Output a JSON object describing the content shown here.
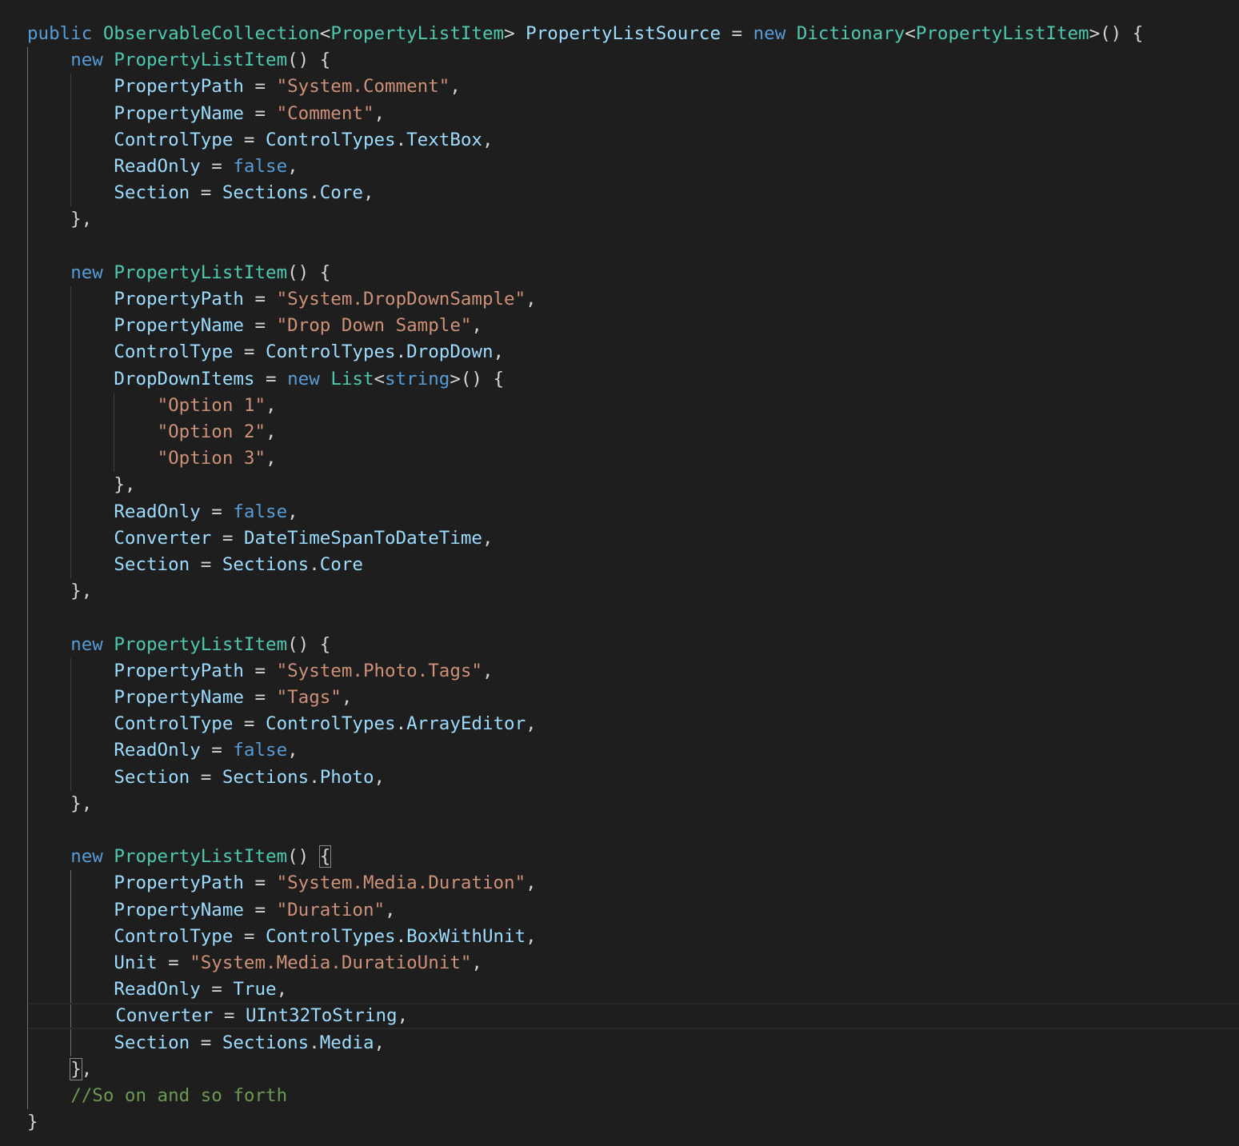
{
  "editor": {
    "language": "C#",
    "theme_colors": {
      "background": "#1e1e1e",
      "keyword": "#569cd6",
      "type": "#4ec9b0",
      "identifier": "#9cdcfe",
      "string": "#ce9178",
      "plain": "#d4d4d4",
      "comment": "#6a9955"
    },
    "lines": [
      [
        [
          "kw",
          "public"
        ],
        [
          "pl",
          " "
        ],
        [
          "ty",
          "ObservableCollection"
        ],
        [
          "pl",
          "<"
        ],
        [
          "ty",
          "PropertyListItem"
        ],
        [
          "pl",
          "> "
        ],
        [
          "id",
          "PropertyListSource"
        ],
        [
          "pl",
          " = "
        ],
        [
          "kw",
          "new"
        ],
        [
          "pl",
          " "
        ],
        [
          "ty",
          "Dictionary"
        ],
        [
          "pl",
          "<"
        ],
        [
          "ty",
          "PropertyListItem"
        ],
        [
          "pl",
          ">() {"
        ]
      ],
      [
        [
          "pl",
          "    "
        ],
        [
          "kw",
          "new"
        ],
        [
          "pl",
          " "
        ],
        [
          "ty",
          "PropertyListItem"
        ],
        [
          "pl",
          "() {"
        ]
      ],
      [
        [
          "pl",
          "        "
        ],
        [
          "id",
          "PropertyPath"
        ],
        [
          "pl",
          " = "
        ],
        [
          "str",
          "\"System.Comment\""
        ],
        [
          "pl",
          ","
        ]
      ],
      [
        [
          "pl",
          "        "
        ],
        [
          "id",
          "PropertyName"
        ],
        [
          "pl",
          " = "
        ],
        [
          "str",
          "\"Comment\""
        ],
        [
          "pl",
          ","
        ]
      ],
      [
        [
          "pl",
          "        "
        ],
        [
          "id",
          "ControlType"
        ],
        [
          "pl",
          " = "
        ],
        [
          "id",
          "ControlTypes"
        ],
        [
          "pl",
          "."
        ],
        [
          "id",
          "TextBox"
        ],
        [
          "pl",
          ","
        ]
      ],
      [
        [
          "pl",
          "        "
        ],
        [
          "id",
          "ReadOnly"
        ],
        [
          "pl",
          " = "
        ],
        [
          "kw",
          "false"
        ],
        [
          "pl",
          ","
        ]
      ],
      [
        [
          "pl",
          "        "
        ],
        [
          "id",
          "Section"
        ],
        [
          "pl",
          " = "
        ],
        [
          "id",
          "Sections"
        ],
        [
          "pl",
          "."
        ],
        [
          "id",
          "Core"
        ],
        [
          "pl",
          ","
        ]
      ],
      [
        [
          "pl",
          "    },"
        ]
      ],
      [],
      [
        [
          "pl",
          "    "
        ],
        [
          "kw",
          "new"
        ],
        [
          "pl",
          " "
        ],
        [
          "ty",
          "PropertyListItem"
        ],
        [
          "pl",
          "() {"
        ]
      ],
      [
        [
          "pl",
          "        "
        ],
        [
          "id",
          "PropertyPath"
        ],
        [
          "pl",
          " = "
        ],
        [
          "str",
          "\"System.DropDownSample\""
        ],
        [
          "pl",
          ","
        ]
      ],
      [
        [
          "pl",
          "        "
        ],
        [
          "id",
          "PropertyName"
        ],
        [
          "pl",
          " = "
        ],
        [
          "str",
          "\"Drop Down Sample\""
        ],
        [
          "pl",
          ","
        ]
      ],
      [
        [
          "pl",
          "        "
        ],
        [
          "id",
          "ControlType"
        ],
        [
          "pl",
          " = "
        ],
        [
          "id",
          "ControlTypes"
        ],
        [
          "pl",
          "."
        ],
        [
          "id",
          "DropDown"
        ],
        [
          "pl",
          ","
        ]
      ],
      [
        [
          "pl",
          "        "
        ],
        [
          "id",
          "DropDownItems"
        ],
        [
          "pl",
          " = "
        ],
        [
          "kw",
          "new"
        ],
        [
          "pl",
          " "
        ],
        [
          "ty",
          "List"
        ],
        [
          "pl",
          "<"
        ],
        [
          "kw",
          "string"
        ],
        [
          "pl",
          ">() {"
        ]
      ],
      [
        [
          "pl",
          "            "
        ],
        [
          "str",
          "\"Option 1\""
        ],
        [
          "pl",
          ","
        ]
      ],
      [
        [
          "pl",
          "            "
        ],
        [
          "str",
          "\"Option 2\""
        ],
        [
          "pl",
          ","
        ]
      ],
      [
        [
          "pl",
          "            "
        ],
        [
          "str",
          "\"Option 3\""
        ],
        [
          "pl",
          ","
        ]
      ],
      [
        [
          "pl",
          "        },"
        ]
      ],
      [
        [
          "pl",
          "        "
        ],
        [
          "id",
          "ReadOnly"
        ],
        [
          "pl",
          " = "
        ],
        [
          "kw",
          "false"
        ],
        [
          "pl",
          ","
        ]
      ],
      [
        [
          "pl",
          "        "
        ],
        [
          "id",
          "Converter"
        ],
        [
          "pl",
          " = "
        ],
        [
          "id",
          "DateTimeSpanToDateTime"
        ],
        [
          "pl",
          ","
        ]
      ],
      [
        [
          "pl",
          "        "
        ],
        [
          "id",
          "Section"
        ],
        [
          "pl",
          " = "
        ],
        [
          "id",
          "Sections"
        ],
        [
          "pl",
          "."
        ],
        [
          "id",
          "Core"
        ]
      ],
      [
        [
          "pl",
          "    },"
        ]
      ],
      [],
      [
        [
          "pl",
          "    "
        ],
        [
          "kw",
          "new"
        ],
        [
          "pl",
          " "
        ],
        [
          "ty",
          "PropertyListItem"
        ],
        [
          "pl",
          "() {"
        ]
      ],
      [
        [
          "pl",
          "        "
        ],
        [
          "id",
          "PropertyPath"
        ],
        [
          "pl",
          " = "
        ],
        [
          "str",
          "\"System.Photo.Tags\""
        ],
        [
          "pl",
          ","
        ]
      ],
      [
        [
          "pl",
          "        "
        ],
        [
          "id",
          "PropertyName"
        ],
        [
          "pl",
          " = "
        ],
        [
          "str",
          "\"Tags\""
        ],
        [
          "pl",
          ","
        ]
      ],
      [
        [
          "pl",
          "        "
        ],
        [
          "id",
          "ControlType"
        ],
        [
          "pl",
          " = "
        ],
        [
          "id",
          "ControlTypes"
        ],
        [
          "pl",
          "."
        ],
        [
          "id",
          "ArrayEditor"
        ],
        [
          "pl",
          ","
        ]
      ],
      [
        [
          "pl",
          "        "
        ],
        [
          "id",
          "ReadOnly"
        ],
        [
          "pl",
          " = "
        ],
        [
          "kw",
          "false"
        ],
        [
          "pl",
          ","
        ]
      ],
      [
        [
          "pl",
          "        "
        ],
        [
          "id",
          "Section"
        ],
        [
          "pl",
          " = "
        ],
        [
          "id",
          "Sections"
        ],
        [
          "pl",
          "."
        ],
        [
          "id",
          "Photo"
        ],
        [
          "pl",
          ","
        ]
      ],
      [
        [
          "pl",
          "    },"
        ]
      ],
      [],
      [
        [
          "pl",
          "    "
        ],
        [
          "kw",
          "new"
        ],
        [
          "pl",
          " "
        ],
        [
          "ty",
          "PropertyListItem"
        ],
        [
          "pl",
          "() "
        ],
        [
          "box",
          "{"
        ]
      ],
      [
        [
          "pl",
          "        "
        ],
        [
          "id",
          "PropertyPath"
        ],
        [
          "pl",
          " = "
        ],
        [
          "str",
          "\"System.Media.Duration\""
        ],
        [
          "pl",
          ","
        ]
      ],
      [
        [
          "pl",
          "        "
        ],
        [
          "id",
          "PropertyName"
        ],
        [
          "pl",
          " = "
        ],
        [
          "str",
          "\"Duration\""
        ],
        [
          "pl",
          ","
        ]
      ],
      [
        [
          "pl",
          "        "
        ],
        [
          "id",
          "ControlType"
        ],
        [
          "pl",
          " = "
        ],
        [
          "id",
          "ControlTypes"
        ],
        [
          "pl",
          "."
        ],
        [
          "id",
          "BoxWithUnit"
        ],
        [
          "pl",
          ","
        ]
      ],
      [
        [
          "pl",
          "        "
        ],
        [
          "id",
          "Unit"
        ],
        [
          "pl",
          " = "
        ],
        [
          "str",
          "\"System.Media.DuratioUnit\""
        ],
        [
          "pl",
          ","
        ]
      ],
      [
        [
          "pl",
          "        "
        ],
        [
          "id",
          "ReadOnly"
        ],
        [
          "pl",
          " = "
        ],
        [
          "id",
          "True"
        ],
        [
          "pl",
          ","
        ]
      ],
      [
        [
          "pl",
          "        "
        ],
        [
          "id",
          "Converter"
        ],
        [
          "pl",
          " = "
        ],
        [
          "id",
          "UInt32ToString"
        ],
        [
          "pl",
          ","
        ]
      ],
      [
        [
          "pl",
          "        "
        ],
        [
          "id",
          "Section"
        ],
        [
          "pl",
          " = "
        ],
        [
          "id",
          "Sections"
        ],
        [
          "pl",
          "."
        ],
        [
          "id",
          "Media"
        ],
        [
          "pl",
          ","
        ]
      ],
      [
        [
          "pl",
          "    "
        ],
        [
          "box",
          "}"
        ],
        [
          "pl",
          ","
        ]
      ],
      [
        [
          "pl",
          "    "
        ],
        [
          "cm",
          "//So on and so forth"
        ]
      ],
      [
        [
          "pl",
          "}"
        ]
      ]
    ],
    "current_line": 37
  }
}
